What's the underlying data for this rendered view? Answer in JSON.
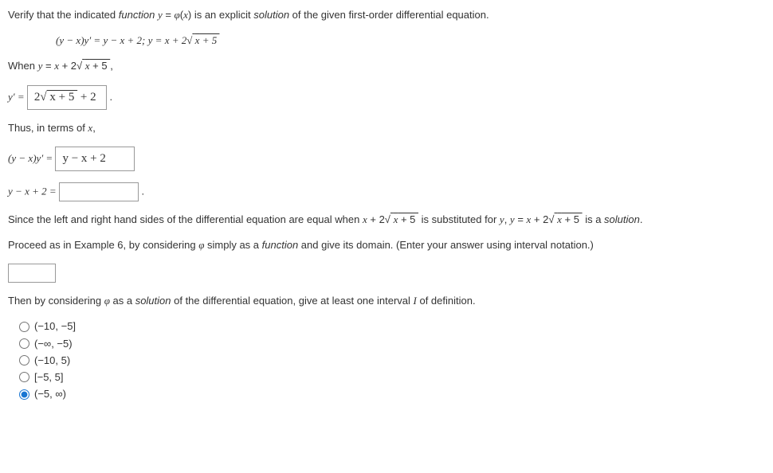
{
  "intro": "Verify that the indicated function y = φ(x) is an explicit solution of the given first-order differential equation.",
  "equation_line": "(y − x)y′ = y − x + 2;    y = x + 2√(x + 5)",
  "when_line": "When y = x + 2√(x + 5),",
  "yprime_prefix": "y′ = ",
  "yprime_input": "2√(x + 5) + 2",
  "yprime_suffix": " .",
  "thus_line": "Thus, in terms of x,",
  "lhs_prefix": "(y − x)y′ = ",
  "lhs_input": "y − x + 2",
  "rhs_prefix": "y − x + 2 = ",
  "rhs_input": "",
  "rhs_suffix": " .",
  "conclusion": "Since the left and right hand sides of the differential equation are equal when x + 2√(x + 5) is substituted for y, y = x + 2√(x + 5) is a solution.",
  "proceed": "Proceed as in Example 6, by considering φ simply as a function and give its domain. (Enter your answer using interval notation.)",
  "domain_input": "",
  "then_line": "Then by considering φ as a solution of the differential equation, give at least one interval I of definition.",
  "options": {
    "o1": "(−10, −5]",
    "o2": "(−∞, −5)",
    "o3": "(−10, 5)",
    "o4": "[−5, 5]",
    "o5": "(−5, ∞)"
  }
}
